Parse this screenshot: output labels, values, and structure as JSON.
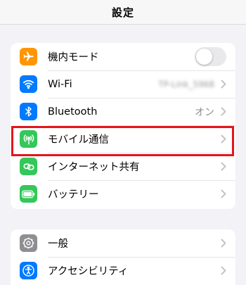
{
  "header": {
    "title": "設定"
  },
  "groups": [
    {
      "items": [
        {
          "label": "機内モード",
          "icon": "airplane-icon",
          "icon_color": "#ff9500",
          "toggle": "off"
        },
        {
          "label": "Wi-Fi",
          "icon": "wifi-icon",
          "icon_color": "#007aff",
          "value": "TP-Link_5968"
        },
        {
          "label": "Bluetooth",
          "icon": "bluetooth-icon",
          "icon_color": "#007aff",
          "value": "オン"
        },
        {
          "label": "モバイル通信",
          "icon": "antenna-icon",
          "icon_color": "#34c759"
        },
        {
          "label": "インターネット共有",
          "icon": "link-icon",
          "icon_color": "#34c759"
        },
        {
          "label": "バッテリー",
          "icon": "battery-icon",
          "icon_color": "#34c759"
        }
      ]
    },
    {
      "items": [
        {
          "label": "一般",
          "icon": "gear-icon",
          "icon_color": "#8e8e93"
        },
        {
          "label": "アクセシビリティ",
          "icon": "accessibility-icon",
          "icon_color": "#007aff"
        }
      ]
    }
  ],
  "highlight": {
    "item": "モバイル通信",
    "color": "#e3151a"
  }
}
